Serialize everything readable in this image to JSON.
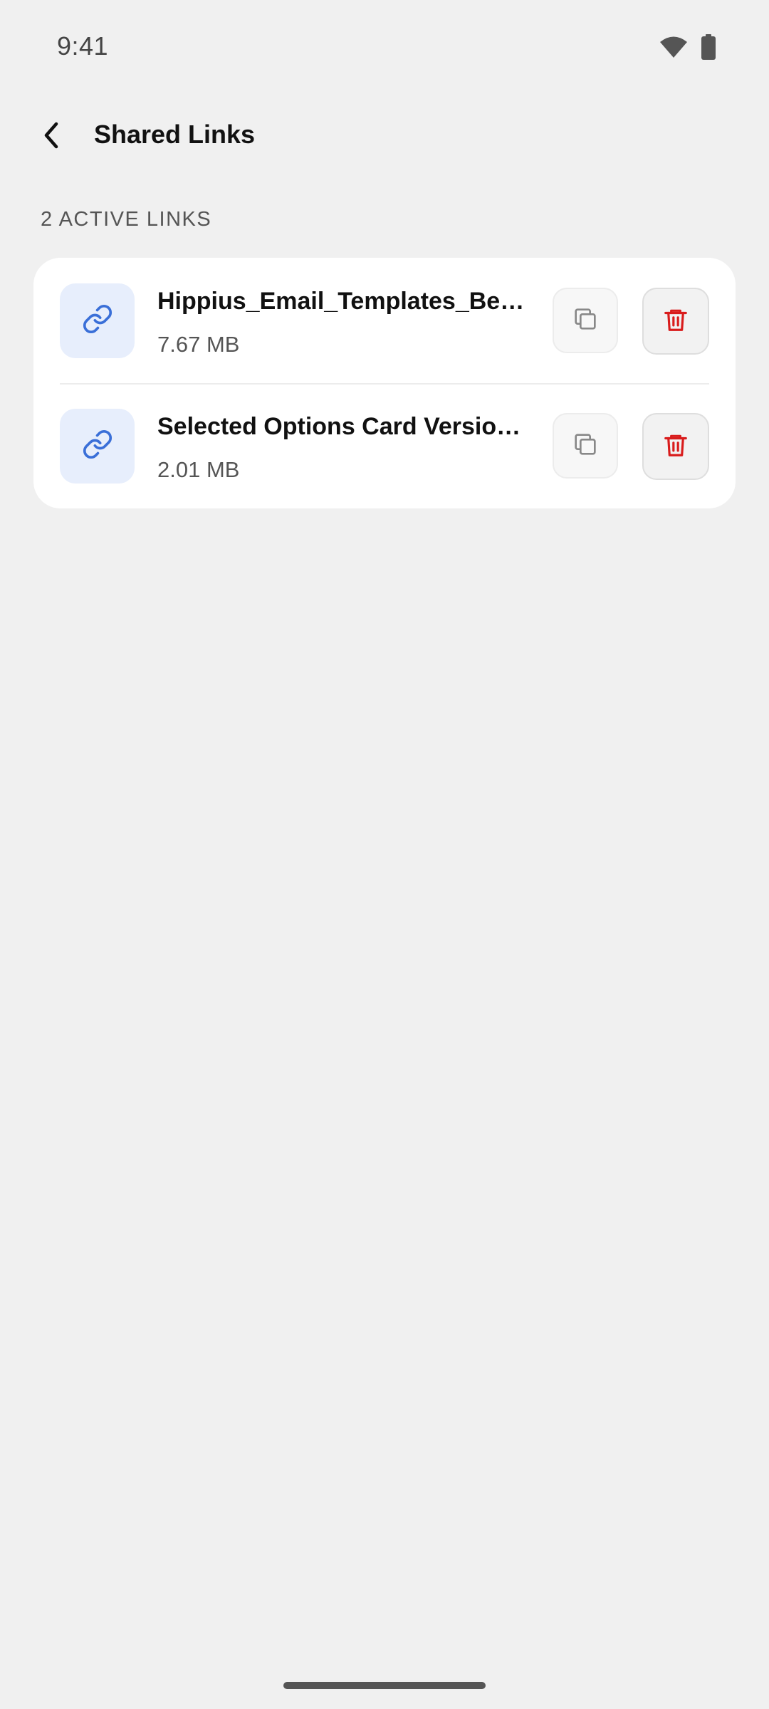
{
  "status_bar": {
    "time": "9:41",
    "icons": [
      "wifi-icon",
      "battery-icon"
    ]
  },
  "header": {
    "back_icon": "chevron-left-icon",
    "title": "Shared Links"
  },
  "section": {
    "label": "2 ACTIVE LINKS"
  },
  "links": [
    {
      "icon": "link-icon",
      "name": "Hippius_Email_Templates_Bef...",
      "size": "7.67 MB",
      "copy_icon": "copy-icon",
      "delete_icon": "trash-icon"
    },
    {
      "icon": "link-icon",
      "name": "Selected Options Card Version...",
      "size": "2.01 MB",
      "copy_icon": "copy-icon",
      "delete_icon": "trash-icon"
    }
  ],
  "colors": {
    "background": "#f0f0f0",
    "card": "#ffffff",
    "link_tile": "#e7eefc",
    "link_icon": "#3a6fd8",
    "delete_icon": "#d91c1c",
    "copy_icon": "#888888"
  }
}
